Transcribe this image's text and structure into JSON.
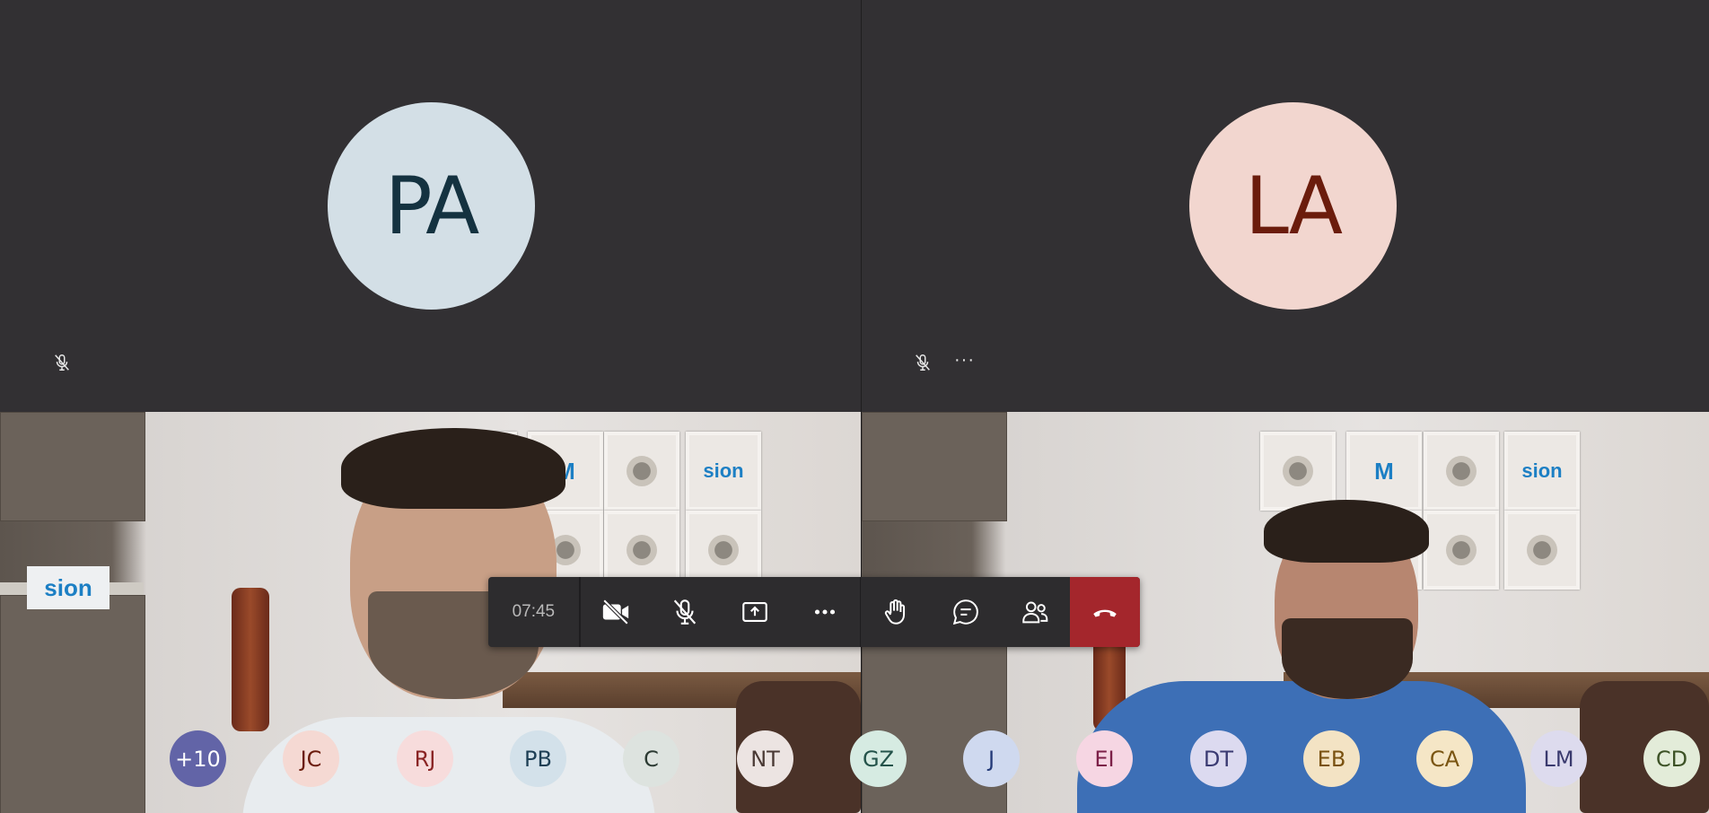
{
  "tiles": {
    "top_left": {
      "initials": "PA",
      "muted": true
    },
    "top_right": {
      "initials": "LA",
      "muted": true,
      "more_label": "···"
    }
  },
  "video_tiles": {
    "left": {
      "sign_text": "sion",
      "frame_logo": "sion"
    },
    "right": {
      "frame_logo": "sion"
    }
  },
  "controls": {
    "timer": "07:45",
    "buttons": [
      {
        "icon": "camera-off-icon"
      },
      {
        "icon": "mic-off-icon"
      },
      {
        "icon": "share-screen-icon"
      },
      {
        "icon": "more-icon"
      },
      {
        "icon": "raise-hand-icon"
      },
      {
        "icon": "chat-icon"
      },
      {
        "icon": "participants-icon"
      },
      {
        "icon": "hang-up-icon",
        "color": "#a4262c"
      }
    ]
  },
  "participants": [
    {
      "initials": "+10",
      "bg": "#6264a7",
      "fg": "#ffffff"
    },
    {
      "initials": "JC",
      "bg": "#f5d9d3",
      "fg": "#6b1c0c"
    },
    {
      "initials": "RJ",
      "bg": "#f7dcdc",
      "fg": "#8a2424"
    },
    {
      "initials": "PB",
      "bg": "#d3e1ea",
      "fg": "#1e3f55"
    },
    {
      "initials": "C",
      "bg": "#dde3df",
      "fg": "#2c3b33"
    },
    {
      "initials": "NT",
      "bg": "#ece4e2",
      "fg": "#4a3a35"
    },
    {
      "initials": "GZ",
      "bg": "#d6ebe2",
      "fg": "#24534a"
    },
    {
      "initials": "J",
      "bg": "#cfd9ef",
      "fg": "#243a78"
    },
    {
      "initials": "EI",
      "bg": "#f6d6e3",
      "fg": "#7c2048"
    },
    {
      "initials": "DT",
      "bg": "#dcdaf0",
      "fg": "#3a3a72"
    },
    {
      "initials": "EB",
      "bg": "#f3e3c4",
      "fg": "#7a5210"
    },
    {
      "initials": "CA",
      "bg": "#f5e6c6",
      "fg": "#7a5512"
    },
    {
      "initials": "LM",
      "bg": "#dddbee",
      "fg": "#3a3a6e"
    },
    {
      "initials": "CD",
      "bg": "#e3ecd9",
      "fg": "#3d5226"
    }
  ]
}
